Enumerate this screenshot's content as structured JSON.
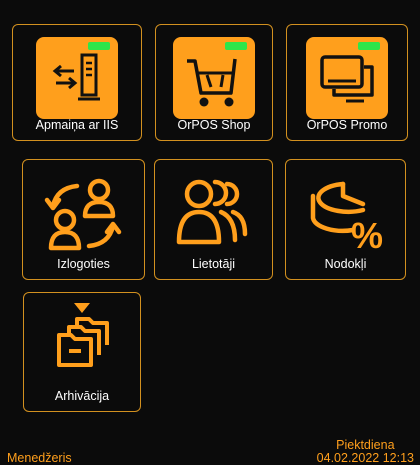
{
  "tiles": [
    {
      "label": "Apmaiņa ar IIS",
      "icon": "exchange-server-icon",
      "status": "online"
    },
    {
      "label": "OrPOS Shop",
      "icon": "shopping-cart-icon",
      "status": "online"
    },
    {
      "label": "OrPOS Promo",
      "icon": "promo-monitor-icon",
      "status": "online"
    },
    {
      "label": "Izlogoties",
      "icon": "switch-user-icon"
    },
    {
      "label": "Lietotāji",
      "icon": "users-icon"
    },
    {
      "label": "Nodokļi",
      "icon": "tax-percent-icon"
    },
    {
      "label": "Arhivācija",
      "icon": "archive-folders-icon"
    }
  ],
  "footer": {
    "role": "Menedžeris",
    "weekday": "Piektdiena",
    "datetime": "04.02.2022 12:13"
  },
  "colors": {
    "accent": "#ff9f1c",
    "border": "#d2901f",
    "status_online": "#2ee54a",
    "background": "#0b0b0b"
  }
}
